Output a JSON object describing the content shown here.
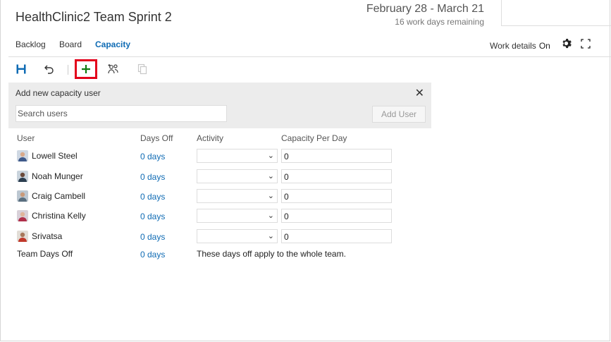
{
  "header": {
    "title": "HealthClinic2 Team Sprint 2",
    "date_range": "February 28 - March 21",
    "remaining": "16 work days remaining"
  },
  "tabs": [
    {
      "label": "Backlog",
      "active": false
    },
    {
      "label": "Board",
      "active": false
    },
    {
      "label": "Capacity",
      "active": true
    }
  ],
  "work_details": {
    "label": "Work details",
    "value": "On"
  },
  "toolbar": {
    "icons": [
      "save-icon",
      "undo-icon",
      "add-icon",
      "add-team-members-icon",
      "copy-icon"
    ]
  },
  "add_panel": {
    "title": "Add new capacity user",
    "search_placeholder": "Search users",
    "add_button": "Add User"
  },
  "columns": {
    "user": "User",
    "days_off": "Days Off",
    "activity": "Activity",
    "capacity": "Capacity Per Day"
  },
  "users": [
    {
      "name": "Lowell Steel",
      "days_off": "0 days",
      "activity": "",
      "capacity": "0"
    },
    {
      "name": "Noah Munger",
      "days_off": "0 days",
      "activity": "",
      "capacity": "0"
    },
    {
      "name": "Craig Cambell",
      "days_off": "0 days",
      "activity": "",
      "capacity": "0"
    },
    {
      "name": "Christina Kelly",
      "days_off": "0 days",
      "activity": "",
      "capacity": "0"
    },
    {
      "name": "Srivatsa",
      "days_off": "0 days",
      "activity": "",
      "capacity": "0"
    }
  ],
  "team": {
    "label": "Team Days Off",
    "days_off": "0 days",
    "note": "These days off apply to the whole team."
  },
  "colors": {
    "accent": "#0f6bb4",
    "highlight": "#e3001b",
    "add_green": "#107c10"
  }
}
